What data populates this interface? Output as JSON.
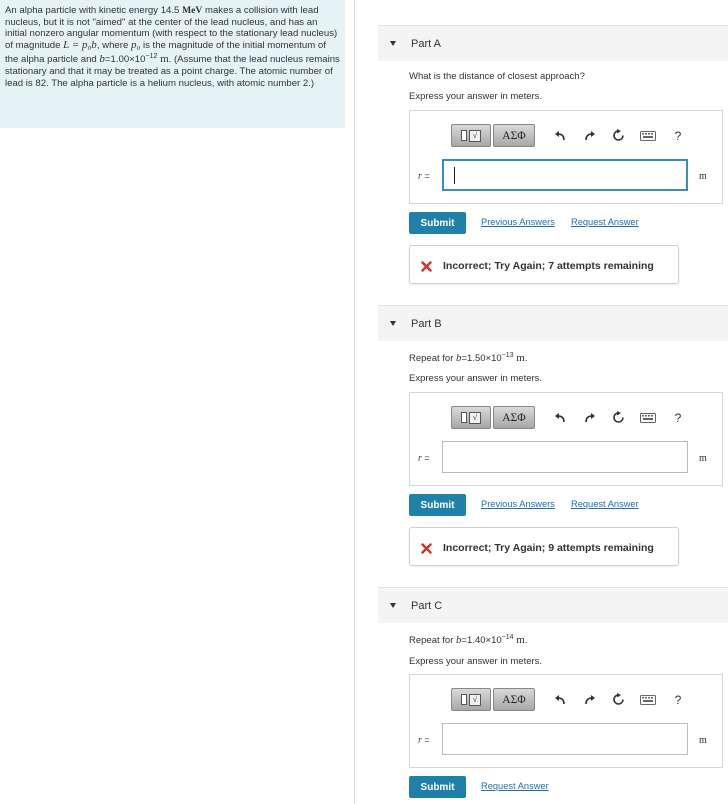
{
  "problem": {
    "text_1": "An alpha particle with kinetic energy 14.5 ",
    "mev": "MeV",
    "text_2": " makes a collision with lead nucleus, but it is not \"aimed\" at the center of the lead nucleus, and has an initial nonzero angular momentum (with respect to the stationary lead nucleus) of magnitude ",
    "L_expr": "L = p₀b",
    "text_3": ", where ",
    "p0": "p₀",
    "text_4": " is the magnitude of the initial momentum of the alpha particle and ",
    "b_expr": "b",
    "text_5": "=1.00×10",
    "b_exp": "−12",
    "b_unit": " m",
    "text_6": ". (Assume that the lead nucleus remains stationary and that it may be treated as a point charge. The atomic number of lead is 82. The alpha particle is a helium nucleus, with atomic number 2.)"
  },
  "toolbar": {
    "template_sqrt": "√",
    "greek_label": "ΑΣΦ",
    "help_label": "?"
  },
  "parts": [
    {
      "title": "Part A",
      "question": "What is the distance of closest approach?",
      "express": "Express your answer in meters.",
      "var": "r",
      "eq": " =",
      "unit": "m",
      "submit": "Submit",
      "prev_answers": "Previous Answers",
      "request_answer": "Request Answer",
      "feedback": "Incorrect; Try Again; 7 attempts remaining"
    },
    {
      "title": "Part B",
      "q_prefix": "Repeat for ",
      "q_b": "b",
      "q_mid": "=1.50×10",
      "q_exp": "−13",
      "q_unit": " m",
      "q_end": ".",
      "express": "Express your answer in meters.",
      "var": "r",
      "eq": " =",
      "unit": "m",
      "submit": "Submit",
      "prev_answers": "Previous Answers",
      "request_answer": "Request Answer",
      "feedback": "Incorrect; Try Again; 9 attempts remaining"
    },
    {
      "title": "Part C",
      "q_prefix": "Repeat for ",
      "q_b": "b",
      "q_mid": "=1.40×10",
      "q_exp": "−14",
      "q_unit": " m",
      "q_end": ".",
      "express": "Express your answer in meters.",
      "var": "r",
      "eq": " =",
      "unit": "m",
      "submit": "Submit",
      "request_answer": "Request Answer"
    }
  ],
  "colors": {
    "problem_bg": "#e6f3f6",
    "submit_bg": "#1f81a8",
    "link": "#1f6fb2",
    "input_focus": "#3a8db6",
    "error_x": "#d0312d"
  }
}
